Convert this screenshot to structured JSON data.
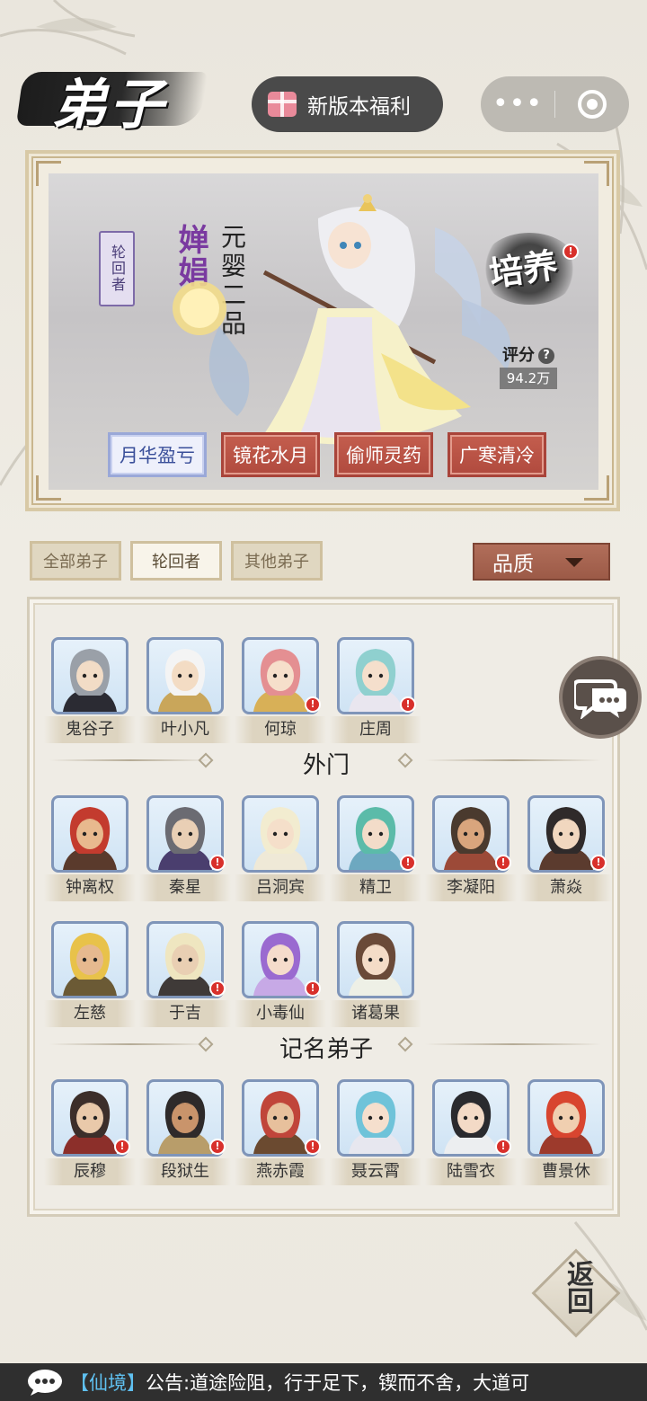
{
  "header": {
    "title": "弟子",
    "promo_label": "新版本福利",
    "menu_more": "•••"
  },
  "hero": {
    "tag": "轮回者",
    "name": "婵娟",
    "rank": "元婴二品",
    "cultivate_label": "培养",
    "score_label": "评分",
    "score_value": "94.2万",
    "skills": [
      "月华盈亏",
      "镜花水月",
      "偷师灵药",
      "广寒清冷"
    ],
    "active_skill_index": 0
  },
  "filters": {
    "tabs": [
      "全部弟子",
      "轮回者",
      "其他弟子"
    ],
    "active_index": 1,
    "sort_label": "品质"
  },
  "roster": {
    "group_top": [
      {
        "name": "鬼谷子",
        "alert": false,
        "hair": "#9aa0a8",
        "skin": "#f2dcc6",
        "robe": "#2b2b33"
      },
      {
        "name": "叶小凡",
        "alert": false,
        "hair": "#f4f4f4",
        "skin": "#f3dcc4",
        "robe": "#c9a65a"
      },
      {
        "name": "何琼",
        "alert": true,
        "hair": "#e48f92",
        "skin": "#f6dfcb",
        "robe": "#d8b057"
      },
      {
        "name": "庄周",
        "alert": true,
        "hair": "#8fd0cf",
        "skin": "#f5dfcc",
        "robe": "#e9e6ef"
      }
    ],
    "section_outer": "外门",
    "group_outer": [
      {
        "name": "钟离权",
        "alert": false,
        "hair": "#c33b2e",
        "skin": "#e8b98e",
        "robe": "#5a3a2c"
      },
      {
        "name": "秦星",
        "alert": true,
        "hair": "#6b6b72",
        "skin": "#e9cfb5",
        "robe": "#4a3e6e"
      },
      {
        "name": "吕洞宾",
        "alert": false,
        "hair": "#f2ecd0",
        "skin": "#f5dfca",
        "robe": "#efe9d7"
      },
      {
        "name": "精卫",
        "alert": true,
        "hair": "#5bbba9",
        "skin": "#f3dcc9",
        "robe": "#6da8c0"
      },
      {
        "name": "李凝阳",
        "alert": true,
        "hair": "#4a3a2e",
        "skin": "#d9a57d",
        "robe": "#9c4a38"
      },
      {
        "name": "萧焱",
        "alert": true,
        "hair": "#2f2a2a",
        "skin": "#f1d7bf",
        "robe": "#5b3b2e"
      },
      {
        "name": "左慈",
        "alert": false,
        "hair": "#e8c24a",
        "skin": "#e6b98f",
        "robe": "#6b5a35"
      },
      {
        "name": "于吉",
        "alert": true,
        "hair": "#efe6c0",
        "skin": "#e9cfb3",
        "robe": "#3f3a38"
      },
      {
        "name": "小毒仙",
        "alert": true,
        "hair": "#9a6ad0",
        "skin": "#f5dccb",
        "robe": "#c7a9e6"
      },
      {
        "name": "诸葛果",
        "alert": false,
        "hair": "#6a4a38",
        "skin": "#f4dcc7",
        "robe": "#eef0e6"
      }
    ],
    "section_named": "记名弟子",
    "group_named": [
      {
        "name": "辰穆",
        "alert": true,
        "hair": "#3c2e2a",
        "skin": "#e9c9aa",
        "robe": "#8c2f2a"
      },
      {
        "name": "段狱生",
        "alert": true,
        "hair": "#2e2a2a",
        "skin": "#c9946b",
        "robe": "#b89d6a"
      },
      {
        "name": "燕赤霞",
        "alert": true,
        "hair": "#c0453a",
        "skin": "#e7c09c",
        "robe": "#6b4a30"
      },
      {
        "name": "聂云霄",
        "alert": false,
        "hair": "#6fc3d9",
        "skin": "#f5dfcd",
        "robe": "#e7e7ef"
      },
      {
        "name": "陆雪衣",
        "alert": true,
        "hair": "#2a2a2e",
        "skin": "#f3dac6",
        "robe": "#eceef0"
      },
      {
        "name": "曹景休",
        "alert": false,
        "hair": "#d8452f",
        "skin": "#f0cfb0",
        "robe": "#9d3a2c"
      }
    ]
  },
  "return_label": "返回",
  "announcement": {
    "realm": "【仙境】",
    "text": "公告:道途险阻，行于足下，锲而不舍，大道可"
  },
  "colors": {
    "skill_red": "#b04a3e",
    "alert_red": "#d8302b",
    "portrait_border": "#7f95b9"
  }
}
